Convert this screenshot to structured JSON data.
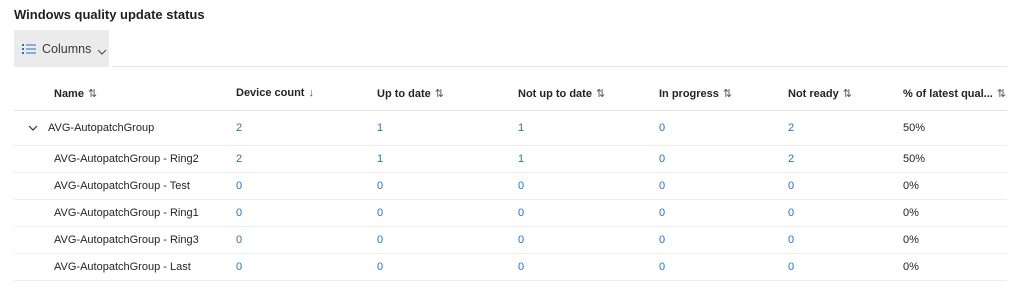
{
  "page": {
    "title": "Windows quality update status",
    "columns_button_label": "Columns"
  },
  "table": {
    "headers": [
      {
        "label": "Name",
        "sort": "⇅"
      },
      {
        "label": "Device count",
        "sort": "↓"
      },
      {
        "label": "Up to date",
        "sort": "⇅"
      },
      {
        "label": "Not up to date",
        "sort": "⇅"
      },
      {
        "label": "In progress",
        "sort": "⇅"
      },
      {
        "label": "Not ready",
        "sort": "⇅"
      },
      {
        "label": "% of latest qual...",
        "sort": "⇅"
      }
    ],
    "group": {
      "name": "AVG-AutopatchGroup",
      "device_count": "2",
      "up_to_date": "1",
      "not_up_to_date": "1",
      "in_progress": "0",
      "not_ready": "2",
      "percent_latest": "50%"
    },
    "rows": [
      {
        "name": "AVG-AutopatchGroup - Ring2",
        "device_count": "2",
        "up_to_date": "1",
        "not_up_to_date": "1",
        "in_progress": "0",
        "not_ready": "2",
        "percent_latest": "50%"
      },
      {
        "name": "AVG-AutopatchGroup - Test",
        "device_count": "0",
        "up_to_date": "0",
        "not_up_to_date": "0",
        "in_progress": "0",
        "not_ready": "0",
        "percent_latest": "0%"
      },
      {
        "name": "AVG-AutopatchGroup - Ring1",
        "device_count": "0",
        "up_to_date": "0",
        "not_up_to_date": "0",
        "in_progress": "0",
        "not_ready": "0",
        "percent_latest": "0%"
      },
      {
        "name": "AVG-AutopatchGroup - Ring3",
        "device_count": "0",
        "up_to_date": "0",
        "not_up_to_date": "0",
        "in_progress": "0",
        "not_ready": "0",
        "percent_latest": "0%"
      },
      {
        "name": "AVG-AutopatchGroup - Last",
        "device_count": "0",
        "up_to_date": "0",
        "not_up_to_date": "0",
        "in_progress": "0",
        "not_ready": "0",
        "percent_latest": "0%"
      }
    ]
  },
  "colors": {
    "link": "#2471c8",
    "toolbar_bg": "#ebebeb"
  },
  "icons": {
    "columns": "columns-list-icon",
    "chevron": "chevron-down-icon",
    "expand": "chevron-expand-icon"
  }
}
